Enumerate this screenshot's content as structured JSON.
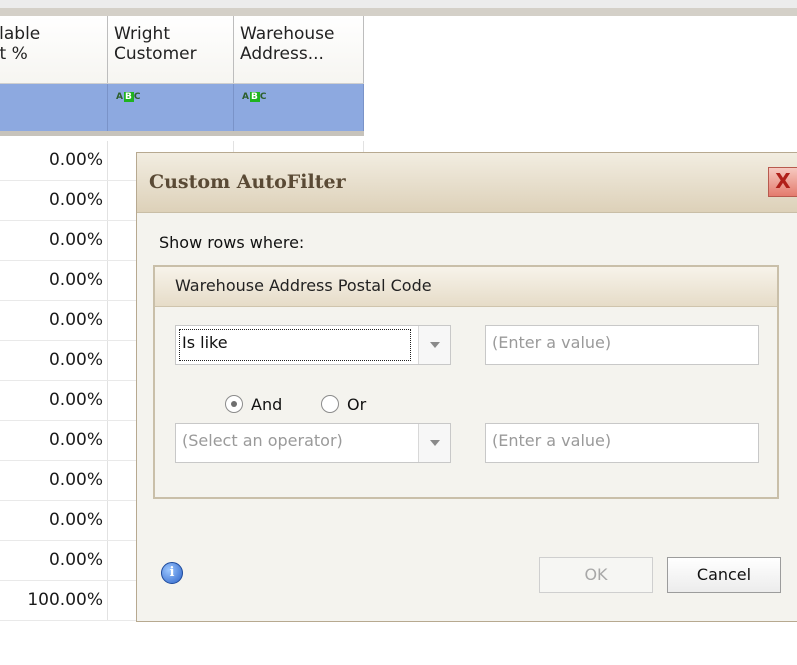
{
  "grid": {
    "headers": [
      {
        "line1": "ailable",
        "line2": "dit %"
      },
      {
        "line1": "Wright",
        "line2": "Customer"
      },
      {
        "line1": "Warehouse",
        "line2": "Address..."
      }
    ],
    "filter_icon_text": {
      "left": "A",
      "mid": "B",
      "right": "C"
    },
    "values": [
      "0.00%",
      "0.00%",
      "0.00%",
      "0.00%",
      "0.00%",
      "0.00%",
      "0.00%",
      "0.00%",
      "0.00%",
      "0.00%",
      "0.00%",
      "100.00%"
    ]
  },
  "dialog": {
    "title": "Custom AutoFilter",
    "close_label": "X",
    "show_rows_label": "Show rows where:",
    "group_title": "Warehouse Address Postal Code",
    "operator1": {
      "value": "Is like"
    },
    "value1": {
      "placeholder": "(Enter a value)"
    },
    "and_label": "And",
    "or_label": "Or",
    "operator2": {
      "placeholder": "(Select an operator)"
    },
    "value2": {
      "placeholder": "(Enter a value)"
    },
    "info_glyph": "i",
    "ok_label": "OK",
    "cancel_label": "Cancel"
  },
  "colors": {
    "filter_row": "#8da9e0",
    "dialog_bg": "#f4f3ee",
    "title_text": "#5a4a35",
    "close_red": "#e47b6e"
  },
  "icons": [
    "abc-filter-icon",
    "close-icon",
    "dropdown-arrow-icon",
    "info-icon",
    "radio-icon"
  ]
}
